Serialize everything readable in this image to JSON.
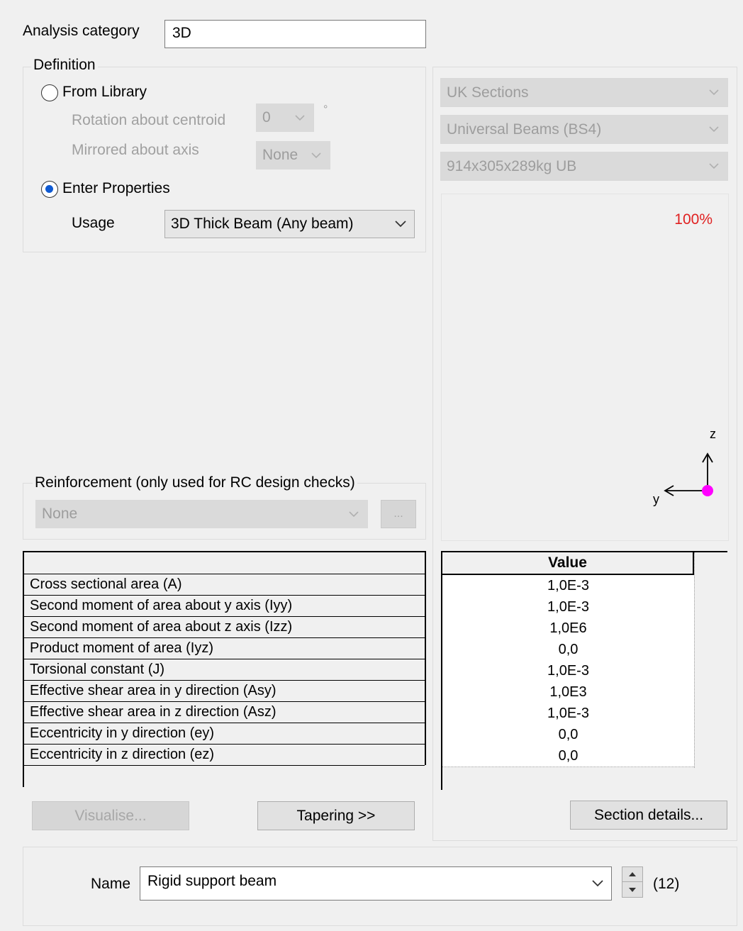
{
  "analysis_category": {
    "label": "Analysis category",
    "value": "3D"
  },
  "definition": {
    "legend": "Definition",
    "from_library_label": "From Library",
    "rotation_label": "Rotation about centroid",
    "rotation_value": "0",
    "degree_symbol": "°",
    "mirrored_label": "Mirrored about axis",
    "mirrored_value": "None",
    "enter_properties_label": "Enter Properties",
    "usage_label": "Usage",
    "usage_value": "3D Thick Beam (Any beam)"
  },
  "library": {
    "catalogue": "UK Sections",
    "family": "Universal Beams (BS4)",
    "section": "914x305x289kg UB"
  },
  "preview": {
    "zoom": "100%",
    "axis_z": "z",
    "axis_y": "y",
    "origin_color": "#ff00ff",
    "zoom_color": "#e02020"
  },
  "reinforcement": {
    "legend": "Reinforcement (only used for RC design checks)",
    "value": "None",
    "browse_label": "..."
  },
  "properties_table": {
    "value_header": "Value",
    "rows": [
      {
        "name": "Cross sectional area (A)",
        "value": "1,0E-3"
      },
      {
        "name": "Second moment of area about y axis (Iyy)",
        "value": "1,0E-3"
      },
      {
        "name": "Second moment of area about z axis (Izz)",
        "value": "1,0E6"
      },
      {
        "name": "Product moment of area (Iyz)",
        "value": "0,0"
      },
      {
        "name": "Torsional constant (J)",
        "value": "1,0E-3"
      },
      {
        "name": "Effective shear area in y direction (Asy)",
        "value": "1,0E3"
      },
      {
        "name": "Effective shear area in z direction (Asz)",
        "value": "1,0E-3"
      },
      {
        "name": "Eccentricity in y direction (ey)",
        "value": "0,0"
      },
      {
        "name": "Eccentricity in z direction (ez)",
        "value": "0,0"
      }
    ]
  },
  "buttons": {
    "visualise": "Visualise...",
    "tapering": "Tapering >>",
    "section_details": "Section details..."
  },
  "name": {
    "label": "Name",
    "value": "Rigid support beam",
    "count": "(12)"
  }
}
